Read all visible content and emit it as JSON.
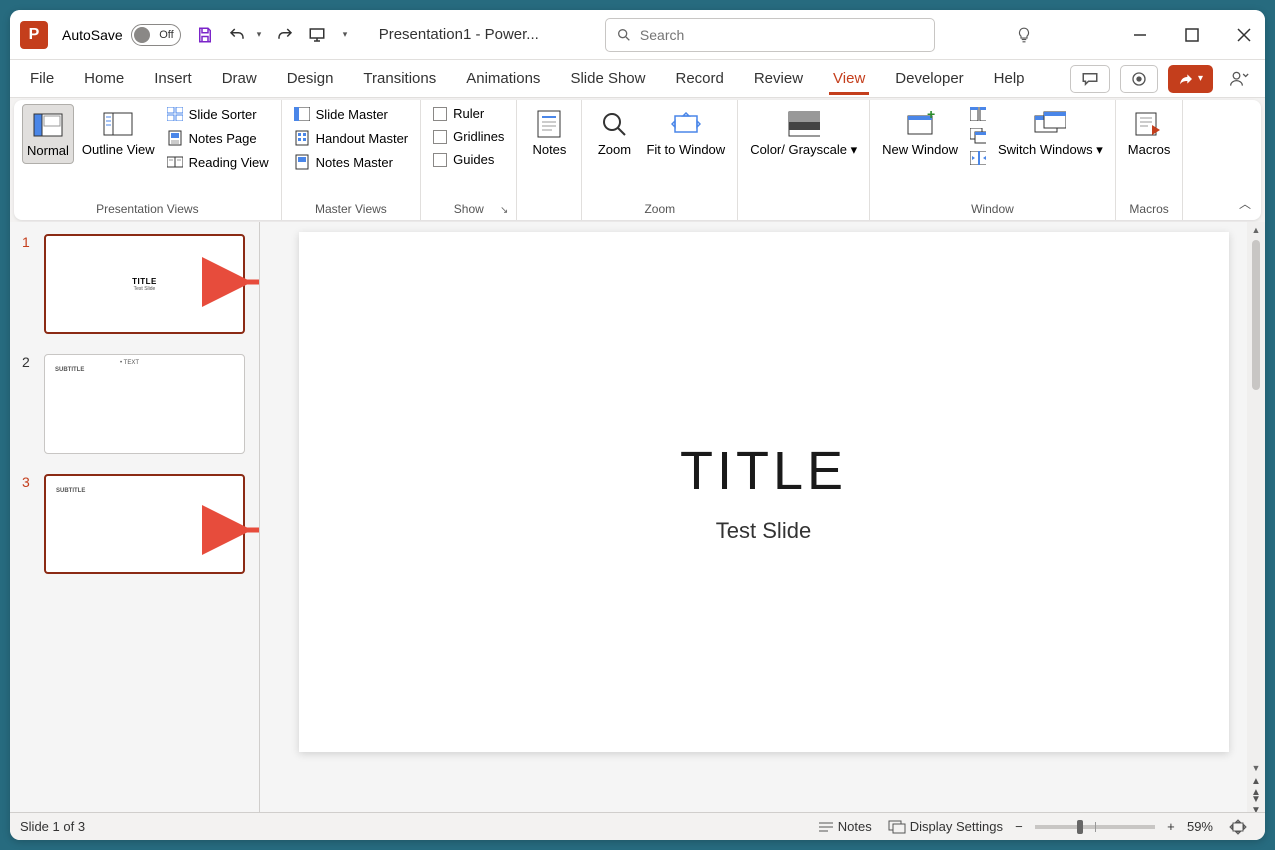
{
  "titlebar": {
    "app_letter": "P",
    "autosave_label": "AutoSave",
    "autosave_state": "Off",
    "doc_title": "Presentation1  -  Power...",
    "search_placeholder": "Search"
  },
  "tabs": {
    "items": [
      "File",
      "Home",
      "Insert",
      "Draw",
      "Design",
      "Transitions",
      "Animations",
      "Slide Show",
      "Record",
      "Review",
      "View",
      "Developer",
      "Help"
    ],
    "active_index": 10
  },
  "ribbon": {
    "presentation_views": {
      "label": "Presentation Views",
      "normal": "Normal",
      "outline": "Outline View",
      "slide_sorter": "Slide Sorter",
      "notes_page": "Notes Page",
      "reading_view": "Reading View"
    },
    "master_views": {
      "label": "Master Views",
      "slide_master": "Slide Master",
      "handout_master": "Handout Master",
      "notes_master": "Notes Master"
    },
    "show": {
      "label": "Show",
      "ruler": "Ruler",
      "gridlines": "Gridlines",
      "guides": "Guides"
    },
    "notes_btn": "Notes",
    "zoom_group": {
      "label": "Zoom",
      "zoom": "Zoom",
      "fit": "Fit to Window"
    },
    "color": {
      "label": "Color/ Grayscale"
    },
    "window": {
      "label": "Window",
      "new_window": "New Window",
      "switch": "Switch Windows"
    },
    "macros": {
      "label": "Macros",
      "macros": "Macros"
    }
  },
  "thumbnails": [
    {
      "num": "1",
      "selected": true,
      "title": "TITLE",
      "sub": "Test Slide"
    },
    {
      "num": "2",
      "selected": false,
      "subtitle": "SUBTITLE",
      "text": "• TEXT"
    },
    {
      "num": "3",
      "selected": true,
      "subtitle": "SUBTITLE"
    }
  ],
  "slide": {
    "title": "TITLE",
    "subtitle": "Test Slide"
  },
  "statusbar": {
    "slide_info": "Slide 1 of 3",
    "notes": "Notes",
    "display": "Display Settings",
    "zoom_pct": "59%"
  }
}
